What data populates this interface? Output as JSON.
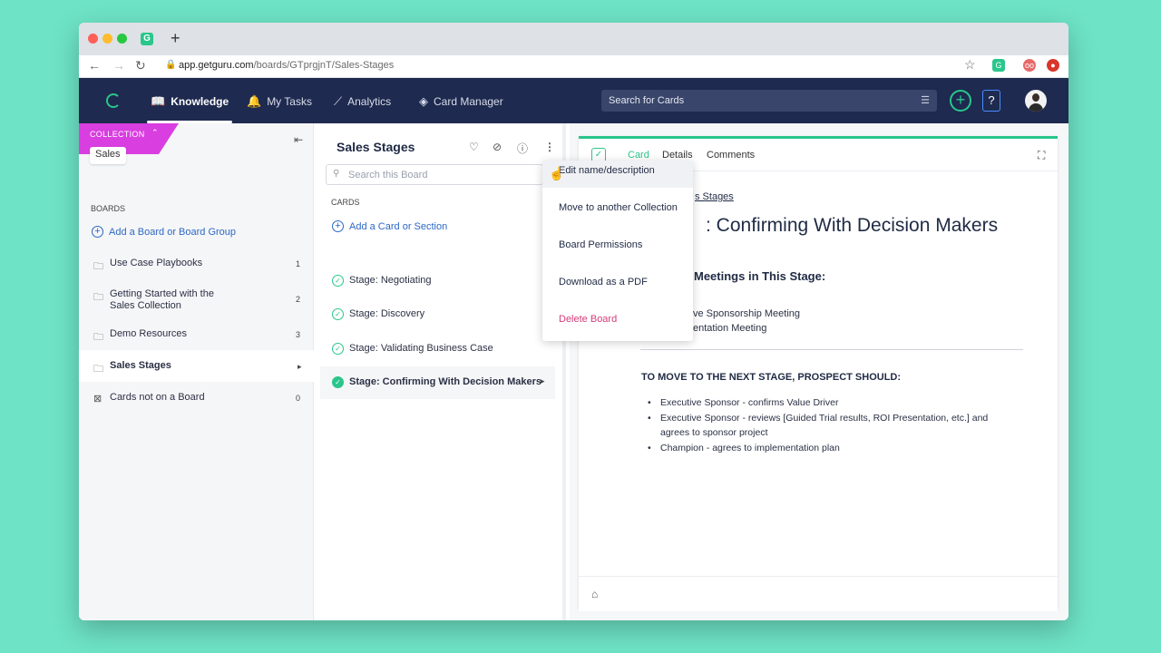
{
  "browser": {
    "url_host": "app.getguru.com",
    "url_path": "/boards/GTprgjnT/Sales-Stages"
  },
  "appbar": {
    "nav": [
      {
        "label": "Knowledge",
        "icon": "book-icon"
      },
      {
        "label": "My Tasks",
        "icon": "bell-icon"
      },
      {
        "label": "Analytics",
        "icon": "chart-icon"
      },
      {
        "label": "Card Manager",
        "icon": "layers-icon"
      }
    ],
    "search_placeholder": "Search for Cards",
    "help_label": "?"
  },
  "sidebar": {
    "collection_label": "COLLECTION",
    "collection_name": "Sales",
    "boards_label": "BOARDS",
    "add_board_label": "Add a Board or Board Group",
    "items": [
      {
        "label": "Use Case Playbooks",
        "count": "1"
      },
      {
        "label": "Getting Started with the Sales Collection",
        "count": "2"
      },
      {
        "label": "Demo Resources",
        "count": "3"
      },
      {
        "label": "Sales Stages",
        "count": ""
      },
      {
        "label": "Cards not on a Board",
        "count": "0"
      }
    ]
  },
  "board": {
    "title": "Sales Stages",
    "search_placeholder": "Search this Board",
    "cards_label": "CARDS",
    "add_card_label": "Add a Card or Section",
    "cards": [
      {
        "label": "Stage: Negotiating"
      },
      {
        "label": "Stage: Discovery"
      },
      {
        "label": "Stage: Validating Business Case"
      },
      {
        "label": "Stage: Confirming With Decision Makers"
      }
    ]
  },
  "menu": {
    "items": [
      {
        "label": "Edit name/description"
      },
      {
        "label": "Move to another Collection"
      },
      {
        "label": "Board Permissions"
      },
      {
        "label": "Download as a PDF"
      },
      {
        "label": "Delete Board"
      }
    ]
  },
  "card": {
    "tabs": [
      "Card",
      "Details",
      "Comments"
    ],
    "breadcrumb": "s Stages",
    "title": ": Confirming With Decision Makers",
    "meetings_heading": "Meetings in This Stage:",
    "meetings": [
      "ve Sponsorship Meeting",
      "entation Meeting"
    ],
    "next_heading": "TO MOVE TO THE NEXT STAGE, PROSPECT SHOULD:",
    "next_items": [
      "Executive Sponsor - confirms Value Driver",
      "Executive Sponsor - reviews [Guided Trial results, ROI Presentation, etc.] and agrees to sponsor project",
      "Champion - agrees to implementation plan"
    ]
  },
  "colors": {
    "background": "#6ee3c6",
    "header": "#1e2a4f",
    "accent_green": "#2ac68b",
    "collection_pink": "#d93ee0",
    "link_blue": "#2d68c4",
    "danger": "#d43c78"
  }
}
